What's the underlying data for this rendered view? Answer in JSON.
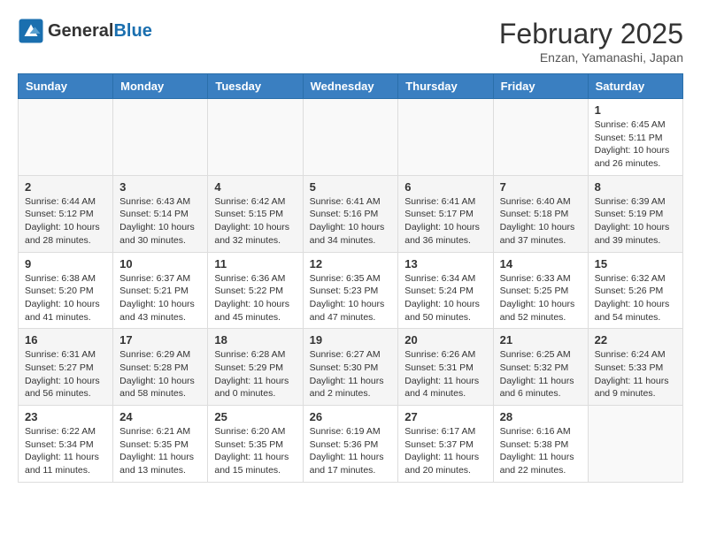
{
  "header": {
    "logo_text_general": "General",
    "logo_text_blue": "Blue",
    "month_year": "February 2025",
    "location": "Enzan, Yamanashi, Japan"
  },
  "weekdays": [
    "Sunday",
    "Monday",
    "Tuesday",
    "Wednesday",
    "Thursday",
    "Friday",
    "Saturday"
  ],
  "weeks": [
    [
      {
        "day": "",
        "info": ""
      },
      {
        "day": "",
        "info": ""
      },
      {
        "day": "",
        "info": ""
      },
      {
        "day": "",
        "info": ""
      },
      {
        "day": "",
        "info": ""
      },
      {
        "day": "",
        "info": ""
      },
      {
        "day": "1",
        "info": "Sunrise: 6:45 AM\nSunset: 5:11 PM\nDaylight: 10 hours and 26 minutes."
      }
    ],
    [
      {
        "day": "2",
        "info": "Sunrise: 6:44 AM\nSunset: 5:12 PM\nDaylight: 10 hours and 28 minutes."
      },
      {
        "day": "3",
        "info": "Sunrise: 6:43 AM\nSunset: 5:14 PM\nDaylight: 10 hours and 30 minutes."
      },
      {
        "day": "4",
        "info": "Sunrise: 6:42 AM\nSunset: 5:15 PM\nDaylight: 10 hours and 32 minutes."
      },
      {
        "day": "5",
        "info": "Sunrise: 6:41 AM\nSunset: 5:16 PM\nDaylight: 10 hours and 34 minutes."
      },
      {
        "day": "6",
        "info": "Sunrise: 6:41 AM\nSunset: 5:17 PM\nDaylight: 10 hours and 36 minutes."
      },
      {
        "day": "7",
        "info": "Sunrise: 6:40 AM\nSunset: 5:18 PM\nDaylight: 10 hours and 37 minutes."
      },
      {
        "day": "8",
        "info": "Sunrise: 6:39 AM\nSunset: 5:19 PM\nDaylight: 10 hours and 39 minutes."
      }
    ],
    [
      {
        "day": "9",
        "info": "Sunrise: 6:38 AM\nSunset: 5:20 PM\nDaylight: 10 hours and 41 minutes."
      },
      {
        "day": "10",
        "info": "Sunrise: 6:37 AM\nSunset: 5:21 PM\nDaylight: 10 hours and 43 minutes."
      },
      {
        "day": "11",
        "info": "Sunrise: 6:36 AM\nSunset: 5:22 PM\nDaylight: 10 hours and 45 minutes."
      },
      {
        "day": "12",
        "info": "Sunrise: 6:35 AM\nSunset: 5:23 PM\nDaylight: 10 hours and 47 minutes."
      },
      {
        "day": "13",
        "info": "Sunrise: 6:34 AM\nSunset: 5:24 PM\nDaylight: 10 hours and 50 minutes."
      },
      {
        "day": "14",
        "info": "Sunrise: 6:33 AM\nSunset: 5:25 PM\nDaylight: 10 hours and 52 minutes."
      },
      {
        "day": "15",
        "info": "Sunrise: 6:32 AM\nSunset: 5:26 PM\nDaylight: 10 hours and 54 minutes."
      }
    ],
    [
      {
        "day": "16",
        "info": "Sunrise: 6:31 AM\nSunset: 5:27 PM\nDaylight: 10 hours and 56 minutes."
      },
      {
        "day": "17",
        "info": "Sunrise: 6:29 AM\nSunset: 5:28 PM\nDaylight: 10 hours and 58 minutes."
      },
      {
        "day": "18",
        "info": "Sunrise: 6:28 AM\nSunset: 5:29 PM\nDaylight: 11 hours and 0 minutes."
      },
      {
        "day": "19",
        "info": "Sunrise: 6:27 AM\nSunset: 5:30 PM\nDaylight: 11 hours and 2 minutes."
      },
      {
        "day": "20",
        "info": "Sunrise: 6:26 AM\nSunset: 5:31 PM\nDaylight: 11 hours and 4 minutes."
      },
      {
        "day": "21",
        "info": "Sunrise: 6:25 AM\nSunset: 5:32 PM\nDaylight: 11 hours and 6 minutes."
      },
      {
        "day": "22",
        "info": "Sunrise: 6:24 AM\nSunset: 5:33 PM\nDaylight: 11 hours and 9 minutes."
      }
    ],
    [
      {
        "day": "23",
        "info": "Sunrise: 6:22 AM\nSunset: 5:34 PM\nDaylight: 11 hours and 11 minutes."
      },
      {
        "day": "24",
        "info": "Sunrise: 6:21 AM\nSunset: 5:35 PM\nDaylight: 11 hours and 13 minutes."
      },
      {
        "day": "25",
        "info": "Sunrise: 6:20 AM\nSunset: 5:35 PM\nDaylight: 11 hours and 15 minutes."
      },
      {
        "day": "26",
        "info": "Sunrise: 6:19 AM\nSunset: 5:36 PM\nDaylight: 11 hours and 17 minutes."
      },
      {
        "day": "27",
        "info": "Sunrise: 6:17 AM\nSunset: 5:37 PM\nDaylight: 11 hours and 20 minutes."
      },
      {
        "day": "28",
        "info": "Sunrise: 6:16 AM\nSunset: 5:38 PM\nDaylight: 11 hours and 22 minutes."
      },
      {
        "day": "",
        "info": ""
      }
    ]
  ]
}
